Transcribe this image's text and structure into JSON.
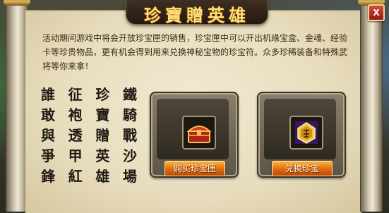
{
  "title": "珍寶贈英雄",
  "close_label": "X",
  "description": "活动期间游戏中将会开放珍宝匣的销售，珍宝匣中可以开出机缘宝盒、金魂、经验卡等珍贵物品，更有机会得到用来兑换神秘宝物的珍宝符。众多珍稀装备和特殊武将等你来拿！",
  "poem_columns": [
    [
      "鐵",
      "騎",
      "戰",
      "沙",
      "場"
    ],
    [
      "珍",
      "寶",
      "贈",
      "英",
      "雄"
    ],
    [
      "征",
      "袍",
      "透",
      "甲",
      "紅"
    ],
    [
      "誰",
      "敢",
      "與",
      "爭",
      "鋒"
    ]
  ],
  "cards": [
    {
      "icon": "treasure-chest-icon",
      "button_label": "购买珍宝匣"
    },
    {
      "icon": "treasure-token-icon",
      "button_label": "兑换珍宝"
    }
  ],
  "colors": {
    "button_orange": "#e06a0c",
    "title_gold": "#ffe27a",
    "close_red": "#c9362a"
  }
}
